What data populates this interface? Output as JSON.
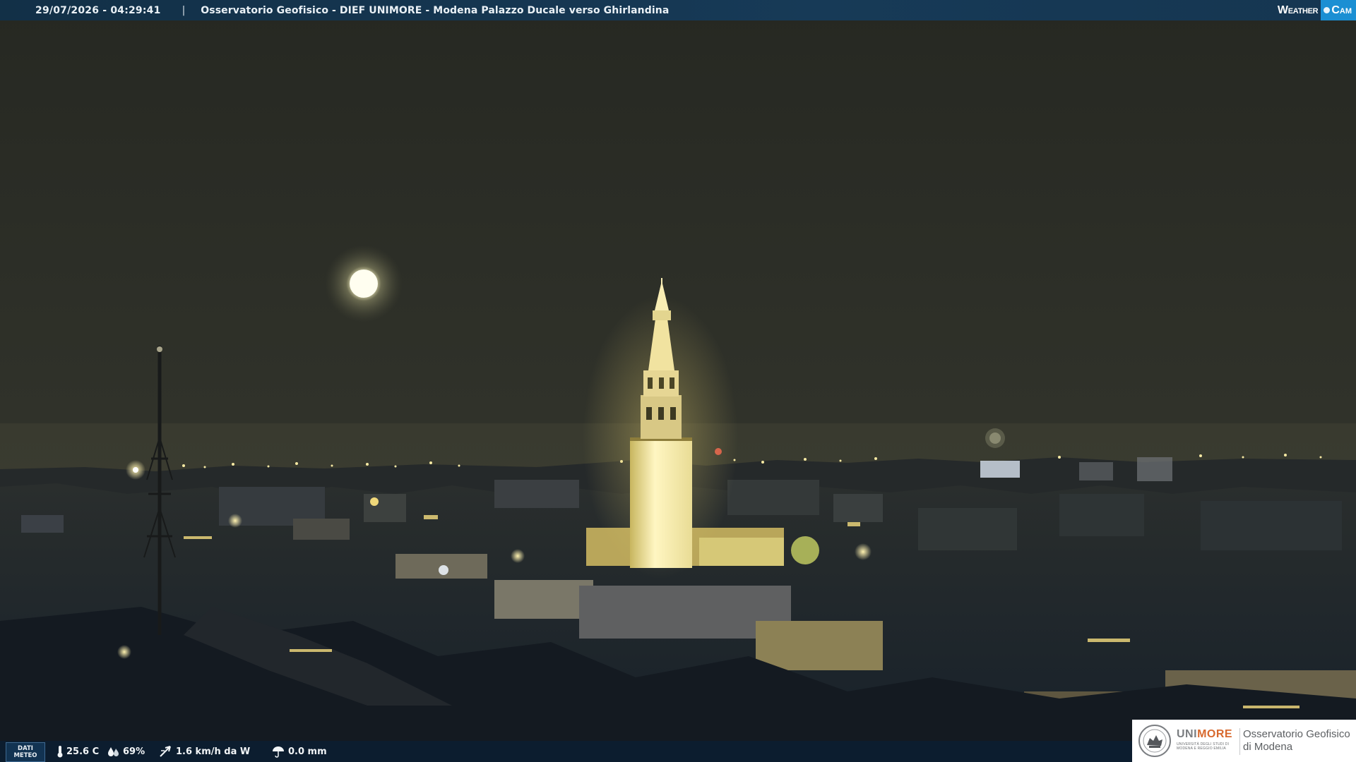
{
  "top_bar": {
    "timestamp": "29/07/2026 - 04:29:41",
    "separator": "|",
    "title": "Osservatorio Geofisico - DIEF UNIMORE - Modena Palazzo Ducale verso Ghirlandina"
  },
  "weathercam_logo": {
    "word": "Weather",
    "cam": "Cam"
  },
  "weather": {
    "badge_line1": "DATI",
    "badge_line2": "METEO",
    "temperature": "25.6 C",
    "humidity": "69%",
    "wind": "1.6 km/h da W",
    "rain": "0.0 mm"
  },
  "unimore_logo": {
    "uni": "UNI",
    "more": "MORE",
    "subtitle": "UNIVERSITÀ DEGLI STUDI DI MODENA E REGGIO EMILIA",
    "line1": "Osservatorio Geofisico",
    "line2": "di Modena"
  },
  "colors": {
    "top_bar": "#153651",
    "bottom_bar": "#0a1e34",
    "sky": "#2f3128",
    "city_lights": "#f5e07a",
    "unimore_orange": "#d8692e",
    "weathercam_blue": "#1b8fd3"
  }
}
